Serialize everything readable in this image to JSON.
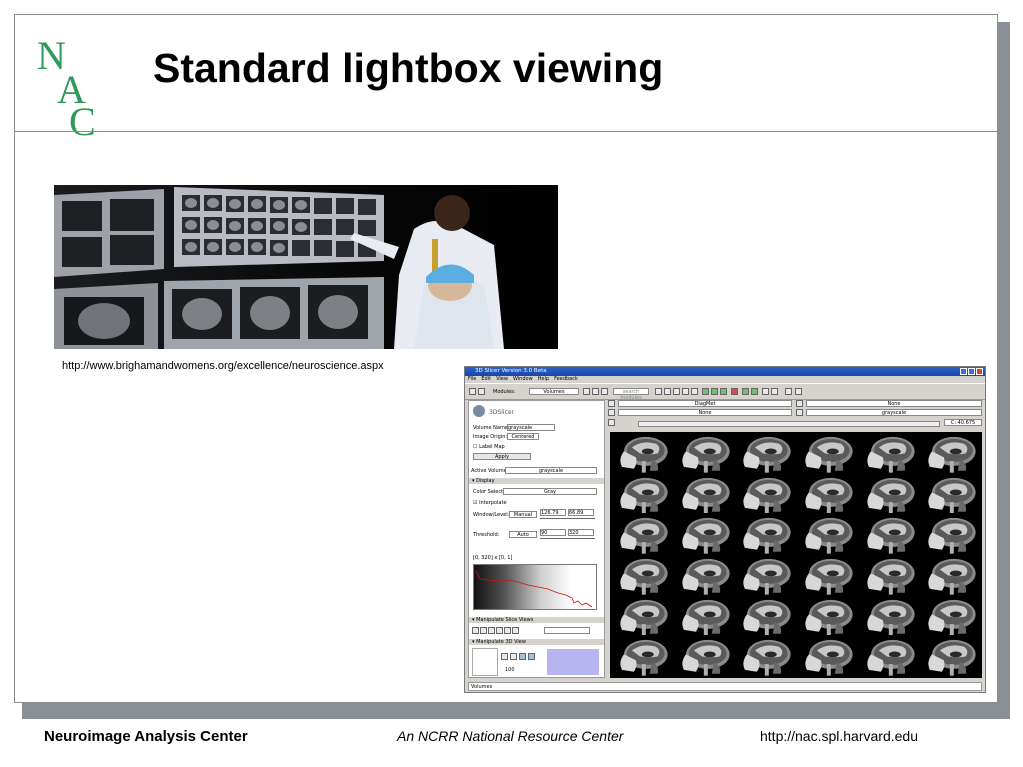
{
  "slide": {
    "logo_letters": [
      "N",
      "A",
      "C"
    ],
    "title": "Standard lightbox viewing",
    "photo_caption_url": "http://www.brighamandwomens.org/excellence/neuroscience.aspx"
  },
  "slicer_window": {
    "title": "3D Slicer Version 3.0 Beta",
    "menu": [
      "File",
      "Edit",
      "View",
      "Window",
      "Help",
      "Feedback"
    ],
    "toolbar": {
      "modules_label": "Modules:",
      "modules_value": "Volumes",
      "search_placeholder": "search modules"
    },
    "left_panel": {
      "logo_text": "3DSlicer",
      "volume_name_label": "Volume Name:",
      "volume_name_value": "grayscale",
      "image_origin_label": "Image Origin:",
      "image_origin_value": "Centered",
      "label_map_label": "Label Map",
      "apply_label": "Apply",
      "active_volume_label": "Active Volume:",
      "active_volume_value": "grayscale",
      "display_section": "Display",
      "color_select_label": "Color Select:",
      "color_select_value": "Gray",
      "interpolate_label": "Interpolate",
      "window_level_label": "Window/Level:",
      "window_level_mode": "Manual",
      "window_value": "126.79",
      "level_value": "66.89",
      "threshold_label": "Threshold:",
      "threshold_mode": "Auto",
      "threshold_low": "90",
      "threshold_high": "320",
      "histogram_range": "[0, 320] x [0, 1]",
      "manipulate_slice_views": "Manipulate Slice Views",
      "manipulate_3d_view": "Manipulate 3D View",
      "zoom_value": "100"
    },
    "viewer": {
      "fg_label": "DiagMet",
      "fg_right": "None",
      "bg_label": "None",
      "bg_right": "grayscale",
      "slice_offset": "C: 40.675"
    },
    "status_text": "Volumes"
  },
  "footer": {
    "left": "Neuroimage Analysis Center",
    "middle": "An NCRR National Resource Center",
    "right": "http://nac.spl.harvard.edu"
  }
}
